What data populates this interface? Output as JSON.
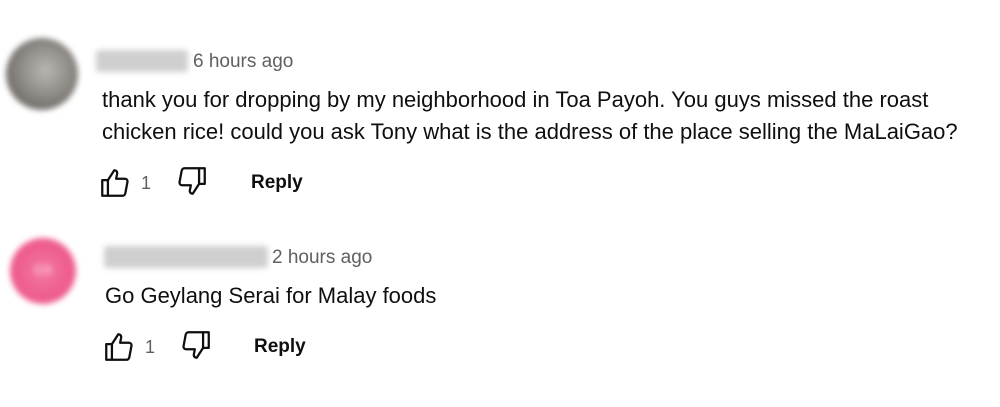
{
  "comments": [
    {
      "avatar_initials": "",
      "timestamp": "6 hours ago",
      "text_lines": [
        "thank you for dropping by my neighborhood in Toa Payoh. You guys missed the roast",
        "chicken rice! could you ask Tony what is the address of the place selling the MaLaiGao?"
      ],
      "like_count": "1",
      "reply_label": "Reply"
    },
    {
      "avatar_initials": "GS",
      "timestamp": "2 hours ago",
      "text_lines": [
        "Go Geylang Serai for Malay foods"
      ],
      "like_count": "1",
      "reply_label": "Reply"
    }
  ],
  "icons": {
    "like": "thumbs-up-icon",
    "dislike": "thumbs-down-icon"
  },
  "colors": {
    "avatar_1": "#8f8b87",
    "avatar_2": "#ee5d8d",
    "timestamp": "#606060",
    "text": "#0f0f0f"
  }
}
